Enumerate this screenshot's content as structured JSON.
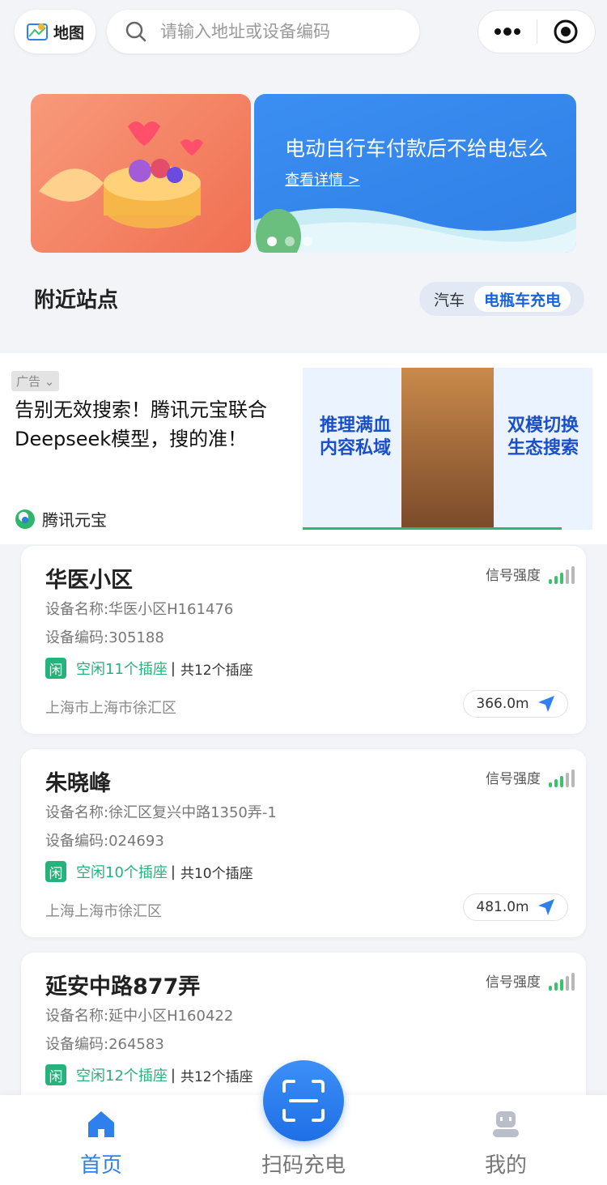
{
  "header": {
    "map_label": "地图",
    "search_placeholder": "请输入地址或设备编码"
  },
  "banner": {
    "title": "电动自行车付款后不给电怎么",
    "detail_link": "查看详情 >"
  },
  "nearby": {
    "title": "附近站点",
    "tabs": [
      "汽车",
      "电瓶车充电"
    ],
    "active_tab": "电瓶车充电"
  },
  "ad": {
    "tag": "广告",
    "headline": "告别无效搜索！腾讯元宝联合Deepseek模型，搜的准！",
    "brand": "腾讯元宝",
    "image_left": "推理满血\n内容私域",
    "image_right": "双模切换\n生态搜索"
  },
  "stations": [
    {
      "name": "华医小区",
      "signal_label": "信号强度",
      "device_name": "设备名称:华医小区H161476",
      "device_code": "设备编码:305188",
      "badge": "闲",
      "free": "空闲11个插座",
      "total": "共12个插座",
      "address": "上海市上海市徐汇区",
      "distance": "366.0m"
    },
    {
      "name": "朱晓峰",
      "signal_label": "信号强度",
      "device_name": "设备名称:徐汇区复兴中路1350弄-1",
      "device_code": "设备编码:024693",
      "badge": "闲",
      "free": "空闲10个插座",
      "total": "共10个插座",
      "address": "上海上海市徐汇区",
      "distance": "481.0m"
    },
    {
      "name": "延安中路877弄",
      "signal_label": "信号强度",
      "device_name": "设备名称:延中小区H160422",
      "device_code": "设备编码:264583",
      "badge": "闲",
      "free": "空闲12个插座",
      "total": "共12个插座"
    }
  ],
  "colors": {
    "accent": "#2f80ed",
    "free_green": "#26b37b",
    "signal_green": "#3cc26b",
    "signal_gray": "#b8b8b8"
  },
  "bottom_nav": {
    "home": "首页",
    "scan": "扫码充电",
    "mine": "我的",
    "active": "首页"
  }
}
